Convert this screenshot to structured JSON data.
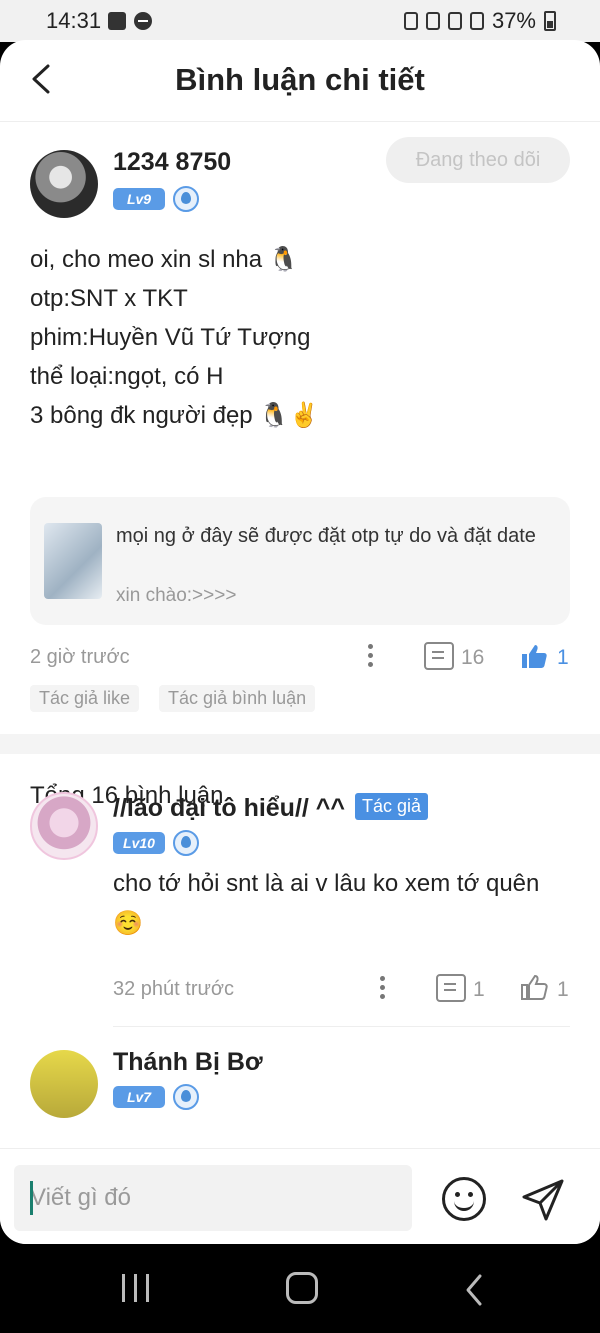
{
  "statusbar": {
    "time": "14:31",
    "battery": "37%"
  },
  "header": {
    "title": "Bình luận chi tiết",
    "back_icon": "chevron-left-icon"
  },
  "post": {
    "username": "1234 8750",
    "level": "Lv9",
    "follow_label": "Đang theo dõi",
    "lines": [
      "oi, cho meo xin sl nha 🐧",
      "otp:SNT x TKT",
      "phim:Huyền Vũ Tứ Tượng",
      "thể loại:ngọt, có H",
      "3 bông đk người đẹp 🐧✌️"
    ],
    "quote": {
      "title": "mọi ng ở đây sẽ được đặt otp tự do và đặt date",
      "subtitle": "xin chào:>>>>"
    },
    "time": "2 giờ trước",
    "comment_count": "16",
    "like_count": "1",
    "tags": [
      "Tác giả like",
      "Tác giả bình luận"
    ]
  },
  "comments": {
    "total_label": "Tổng 16 bình luận",
    "items": [
      {
        "username": "//lão đại tô hiểu// ^^",
        "badge": "Tác giả",
        "level": "Lv10",
        "text": "cho tớ hỏi snt là ai v lâu ko xem tớ quên☺️",
        "time": "32 phút trước",
        "reply_count": "1",
        "like_count": "1"
      },
      {
        "username": "Thánh Bị Bơ",
        "level": "Lv7"
      }
    ]
  },
  "composer": {
    "placeholder": "Viết gì đó"
  },
  "colors": {
    "accent": "#4a90e2",
    "level_badge": "#5a9be6",
    "muted": "#999999"
  }
}
